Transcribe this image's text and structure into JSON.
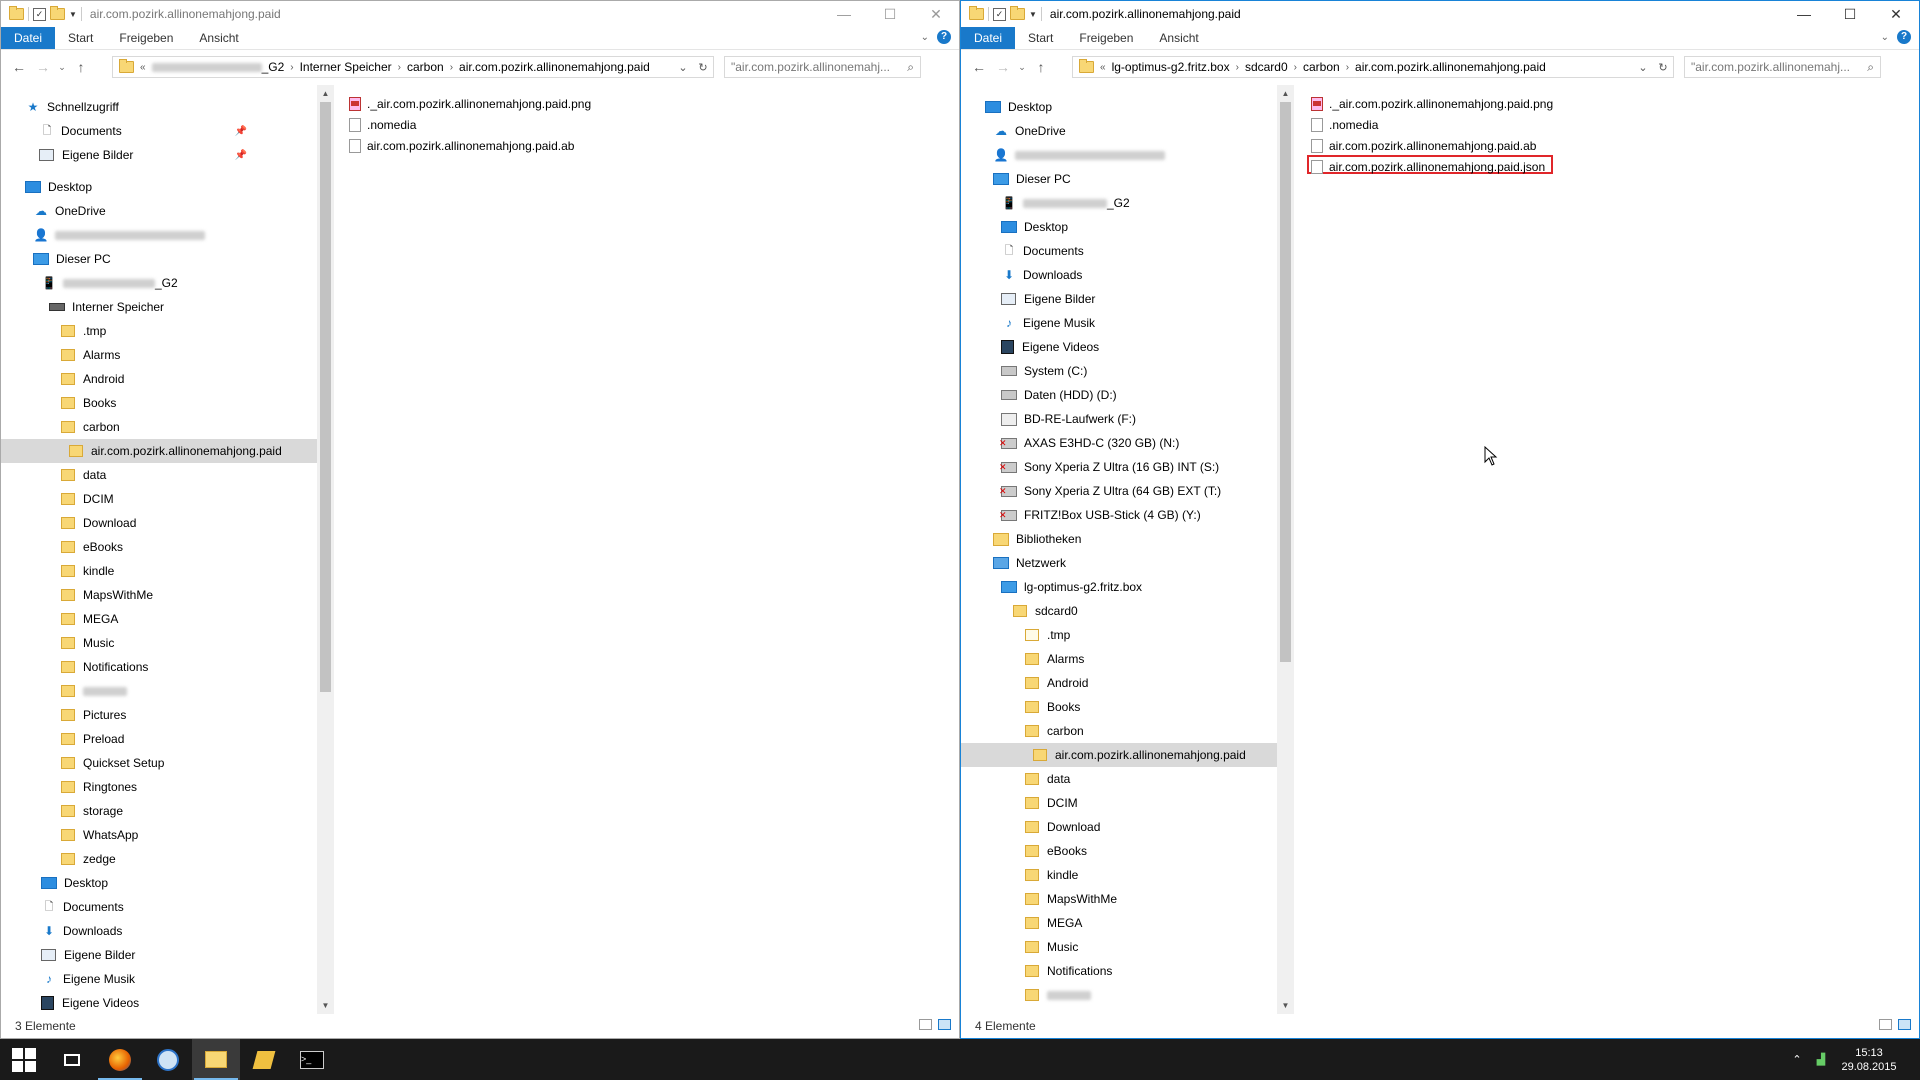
{
  "left_window": {
    "title": "air.com.pozirk.allinonemahjong.paid",
    "ribbon_tabs": [
      "Datei",
      "Start",
      "Freigeben",
      "Ansicht"
    ],
    "address": {
      "prefix": "«",
      "crumbs": [
        "_G2",
        "Interner Speicher",
        "carbon",
        "air.com.pozirk.allinonemahjong.paid"
      ]
    },
    "search_placeholder": "\"air.com.pozirk.allinonemahj...",
    "nav": {
      "schnellzugriff": "Schnellzugriff",
      "documents": "Documents",
      "eigene_bilder": "Eigene Bilder",
      "desktop": "Desktop",
      "onedrive": "OneDrive",
      "dieser_pc": "Dieser PC",
      "device": "_G2",
      "interner_speicher": "Interner Speicher",
      "folders": [
        ".tmp",
        "Alarms",
        "Android",
        "Books",
        "carbon"
      ],
      "selected": "air.com.pozirk.allinonemahjong.paid",
      "folders2": [
        "data",
        "DCIM",
        "Download",
        "eBooks",
        "kindle",
        "MapsWithMe",
        "MEGA",
        "Music",
        "Notifications"
      ],
      "folders3": [
        "Pictures",
        "Preload",
        "Quickset Setup",
        "Ringtones",
        "storage",
        "WhatsApp",
        "zedge"
      ],
      "pc_items": [
        "Desktop",
        "Documents",
        "Downloads",
        "Eigene Bilder",
        "Eigene Musik",
        "Eigene Videos"
      ]
    },
    "files": [
      "._air.com.pozirk.allinonemahjong.paid.png",
      ".nomedia",
      "air.com.pozirk.allinonemahjong.paid.ab"
    ],
    "status": "3 Elemente"
  },
  "right_window": {
    "title": "air.com.pozirk.allinonemahjong.paid",
    "ribbon_tabs": [
      "Datei",
      "Start",
      "Freigeben",
      "Ansicht"
    ],
    "address": {
      "prefix": "«",
      "crumbs": [
        "lg-optimus-g2.fritz.box",
        "sdcard0",
        "carbon",
        "air.com.pozirk.allinonemahjong.paid"
      ]
    },
    "search_placeholder": "\"air.com.pozirk.allinonemahj...",
    "nav": {
      "desktop_top": "Desktop",
      "onedrive": "OneDrive",
      "dieser_pc": "Dieser PC",
      "device": "_G2",
      "pc_items": [
        "Desktop",
        "Documents",
        "Downloads",
        "Eigene Bilder",
        "Eigene Musik",
        "Eigene Videos"
      ],
      "drives": [
        "System (C:)",
        "Daten (HDD) (D:)",
        "BD-RE-Laufwerk (F:)"
      ],
      "net_drives": [
        "AXAS E3HD-C (320 GB) (N:)",
        "Sony Xperia Z Ultra (16 GB) INT (S:)",
        "Sony Xperia Z Ultra (64 GB) EXT (T:)",
        "FRITZ!Box USB-Stick (4 GB) (Y:)"
      ],
      "bibliotheken": "Bibliotheken",
      "netzwerk": "Netzwerk",
      "host": "lg-optimus-g2.fritz.box",
      "sdcard": "sdcard0",
      "folders": [
        ".tmp",
        "Alarms",
        "Android",
        "Books",
        "carbon"
      ],
      "selected": "air.com.pozirk.allinonemahjong.paid",
      "folders2": [
        "data",
        "DCIM",
        "Download",
        "eBooks",
        "kindle",
        "MapsWithMe",
        "MEGA",
        "Music",
        "Notifications"
      ]
    },
    "files": [
      "._air.com.pozirk.allinonemahjong.paid.png",
      ".nomedia",
      "air.com.pozirk.allinonemahjong.paid.ab",
      "air.com.pozirk.allinonemahjong.paid.json"
    ],
    "highlighted_file": "air.com.pozirk.allinonemahjong.paid.json",
    "status": "4 Elemente"
  },
  "taskbar": {
    "time": "15:13",
    "date": "29.08.2015"
  },
  "colors": {
    "accent": "#1979ca",
    "highlight_border": "#e0262a",
    "selection": "#d9d9d9",
    "taskbar": "#1a1a1a"
  }
}
